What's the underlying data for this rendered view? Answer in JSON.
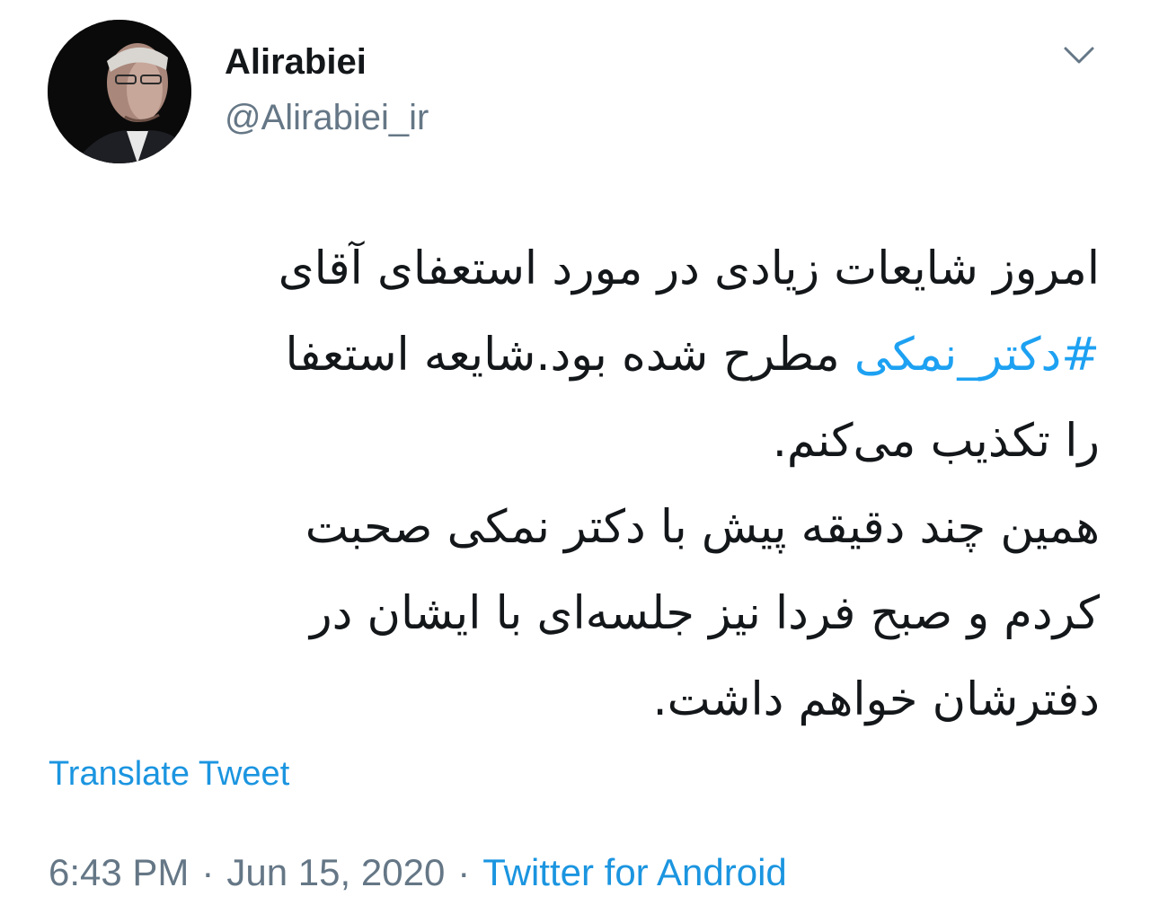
{
  "user": {
    "display_name": "Alirabiei",
    "handle": "@Alirabiei_ir"
  },
  "icons": {
    "avatar": "profile-photo",
    "menu": "chevron-down-icon"
  },
  "tweet": {
    "line1": "امروز شایعات زیادی در مورد استعفای آقای",
    "hashtag": "#دکتر_نمکی",
    "line2_rest": " مطرح شده بود.شایعه استعفا",
    "line3": "را تکذیب می‌کنم.",
    "line4": "همین چند دقیقه پیش با دکتر نمکی صحبت",
    "line5": "کردم و صبح فردا نیز جلسه‌ای با ایشان در",
    "line6": "دفترشان خواهم داشت."
  },
  "translate_label": "Translate Tweet",
  "meta": {
    "time": "6:43 PM",
    "separator": "·",
    "date": "Jun 15, 2020",
    "source": "Twitter for Android"
  },
  "colors": {
    "link": "#1b95e0",
    "hashtag": "#1da1f2",
    "secondary_text": "#657786",
    "primary_text": "#14171a"
  }
}
